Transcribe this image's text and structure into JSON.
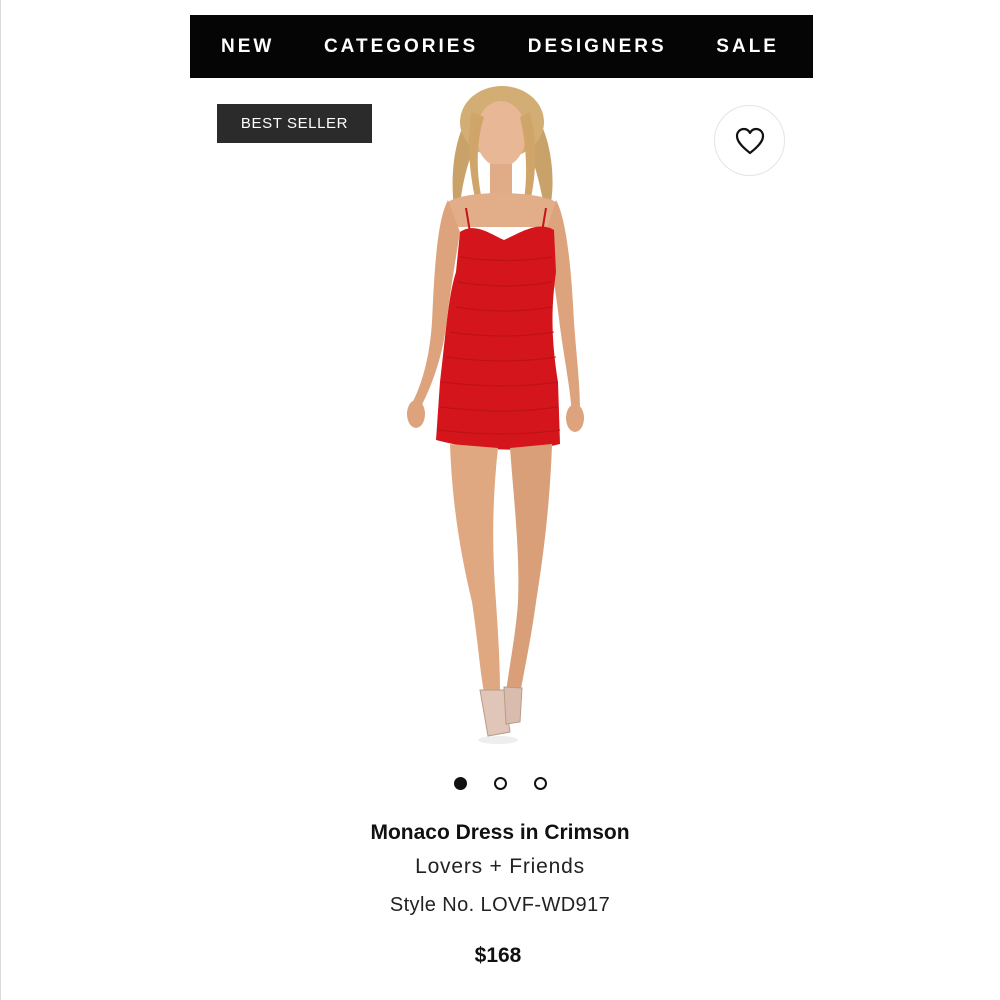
{
  "nav": {
    "items": [
      "NEW",
      "CATEGORIES",
      "DESIGNERS",
      "SALE"
    ]
  },
  "badge": {
    "label": "BEST SELLER"
  },
  "favorite": {
    "icon": "heart-outline-icon"
  },
  "gallery": {
    "image_count": 3,
    "active_index": 0
  },
  "product": {
    "title": "Monaco Dress in Crimson",
    "brand": "Lovers + Friends",
    "style": "Style No. LOVF-WD917",
    "price": "$168"
  },
  "colors": {
    "nav_bg": "#050505",
    "badge_bg": "#2b2b2b",
    "dress": "#d4161c",
    "text": "#111111"
  }
}
